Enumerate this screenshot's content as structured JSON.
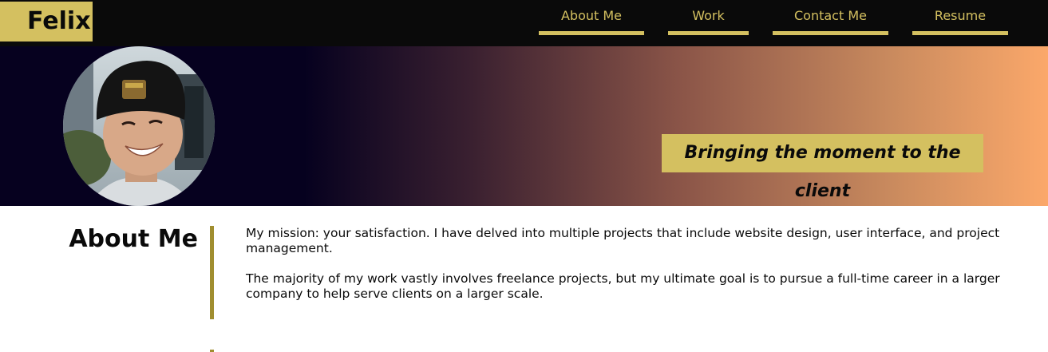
{
  "header": {
    "logo": "Felix",
    "nav": [
      {
        "label": "About Me"
      },
      {
        "label": "Work"
      },
      {
        "label": "Contact Me"
      },
      {
        "label": "Resume"
      }
    ]
  },
  "banner": {
    "tagline": "Bringing the moment to the client"
  },
  "about": {
    "heading": "About Me",
    "paragraphs": [
      "My mission: your satisfaction. I have delved into multiple projects that include website design, user interface, and project management.",
      "The majority of my work vastly involves freelance projects, but my ultimate goal is to pursue a full-time career in a larger company to help serve clients on a larger scale."
    ]
  },
  "colors": {
    "header_bg": "#0a0a0a",
    "accent": "#d4c060",
    "divider": "#a08e30"
  }
}
